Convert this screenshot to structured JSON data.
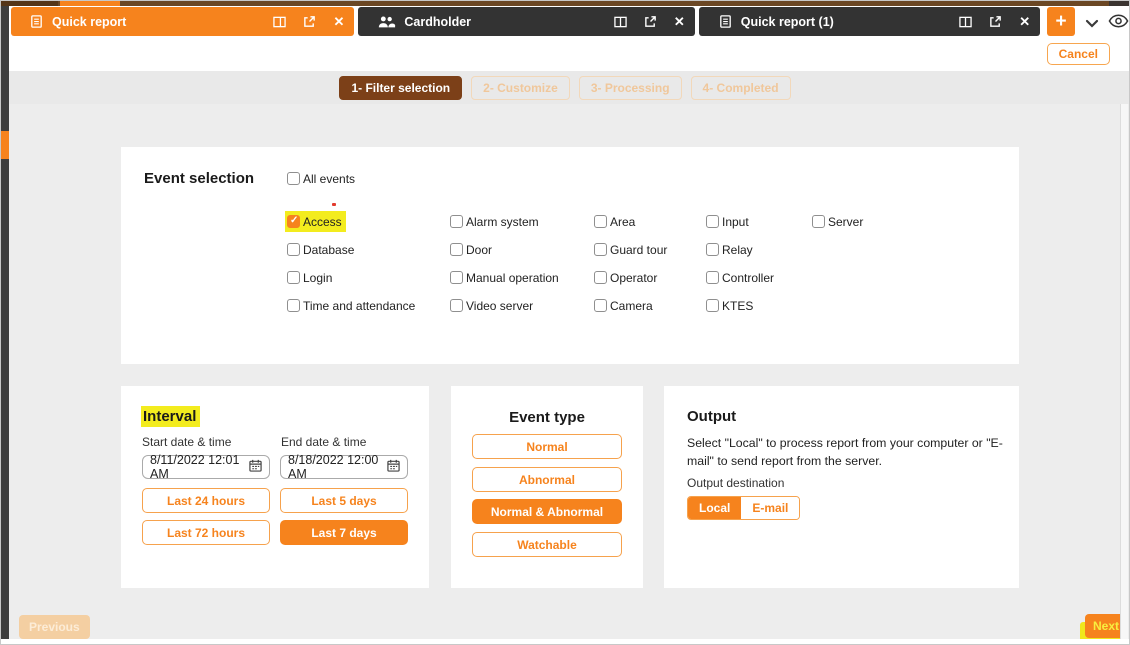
{
  "colors": {
    "accent_orange": "#f6831d",
    "tab_dark": "#333333",
    "step_active_brown": "#7c4018",
    "highlight_yellow": "#f3ec1e",
    "background_gray": "#ededed"
  },
  "icons": {
    "close": "✕",
    "plus": "+",
    "names": [
      "report-icon",
      "cardholder-icon",
      "dock-panel-icon",
      "open-in-new-icon",
      "close-icon",
      "plus-icon",
      "chevron-down-icon",
      "eye-icon",
      "calendar-icon",
      "checkmark-icon"
    ]
  },
  "tabs": {
    "items": [
      {
        "label": "Quick report",
        "active": true
      },
      {
        "label": "Cardholder",
        "active": false
      },
      {
        "label": "Quick report (1)",
        "active": false
      }
    ]
  },
  "toolbar": {
    "cancel_label": "Cancel"
  },
  "steps": {
    "items": [
      "1- Filter selection",
      "2- Customize",
      "3- Processing",
      "4- Completed"
    ],
    "active_index": 0
  },
  "event_selection": {
    "title": "Event selection",
    "all_events_label": "All events",
    "columns": [
      [
        "Access",
        "Database",
        "Login",
        "Time and attendance"
      ],
      [
        "Alarm system",
        "Door",
        "Manual operation",
        "Video server"
      ],
      [
        "Area",
        "Guard tour",
        "Operator",
        "Camera"
      ],
      [
        "Input",
        "Relay",
        "Controller",
        "KTES"
      ],
      [
        "Server"
      ]
    ],
    "checked": [
      "Access"
    ],
    "highlighted": [
      "Access"
    ]
  },
  "interval": {
    "title": "Interval",
    "start_label": "Start date & time",
    "end_label": "End date & time",
    "start_value": "8/11/2022 12:01 AM",
    "end_value": "8/18/2022 12:00 AM",
    "quick_buttons": [
      "Last 24 hours",
      "Last 5 days",
      "Last 72 hours",
      "Last 7 days"
    ],
    "active_quick_button": "Last 7 days"
  },
  "event_type": {
    "title": "Event type",
    "options": [
      "Normal",
      "Abnormal",
      "Normal & Abnormal",
      "Watchable"
    ],
    "active_option": "Normal & Abnormal"
  },
  "output": {
    "title": "Output",
    "description": "Select \"Local\" to process report from your computer or \"E-mail\" to send report from the server.",
    "destination_label": "Output destination",
    "destinations": [
      "Local",
      "E-mail"
    ],
    "active_destination": "Local"
  },
  "footer": {
    "previous_label": "Previous",
    "next_label": "Next"
  }
}
